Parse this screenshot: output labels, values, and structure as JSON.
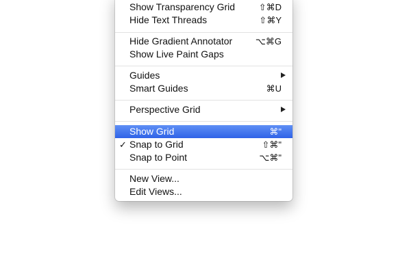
{
  "menu": {
    "groups": [
      {
        "items": [
          {
            "label": "Show Transparency Grid",
            "shortcut": "⇧⌘D"
          },
          {
            "label": "Hide Text Threads",
            "shortcut": "⇧⌘Y"
          }
        ]
      },
      {
        "items": [
          {
            "label": "Hide Gradient Annotator",
            "shortcut": "⌥⌘G"
          },
          {
            "label": "Show Live Paint Gaps",
            "shortcut": ""
          }
        ]
      },
      {
        "items": [
          {
            "label": "Guides",
            "submenu": true
          },
          {
            "label": "Smart Guides",
            "shortcut": "⌘U"
          }
        ]
      },
      {
        "items": [
          {
            "label": "Perspective Grid",
            "submenu": true
          }
        ]
      },
      {
        "items": [
          {
            "label": "Show Grid",
            "shortcut": "⌘\"",
            "highlighted": true
          },
          {
            "label": "Snap to Grid",
            "shortcut": "⇧⌘\"",
            "checked": true
          },
          {
            "label": "Snap to Point",
            "shortcut": "⌥⌘\""
          }
        ]
      },
      {
        "items": [
          {
            "label": "New View...",
            "shortcut": ""
          },
          {
            "label": "Edit Views...",
            "shortcut": ""
          }
        ]
      }
    ],
    "check_glyph": "✓",
    "highlight_color": "#3a6fe9"
  }
}
